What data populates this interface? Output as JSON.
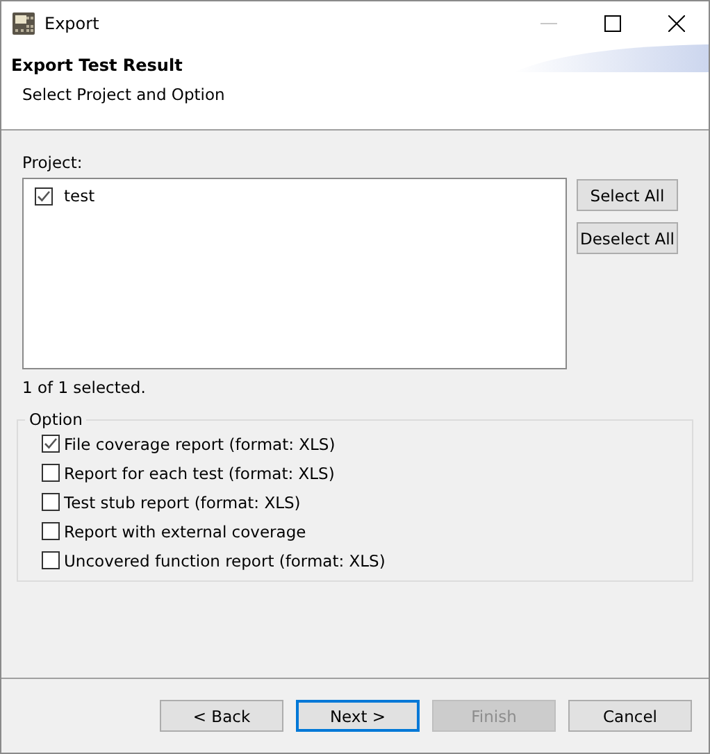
{
  "window": {
    "title": "Export",
    "minimize_disabled": true
  },
  "header": {
    "title": "Export Test Result",
    "subtitle": "Select Project and Option"
  },
  "project": {
    "label": "Project:",
    "items": [
      {
        "label": "test",
        "checked": true
      }
    ],
    "buttons": [
      "Select All",
      "Deselect All"
    ],
    "status": "1 of 1 selected."
  },
  "option": {
    "title": "Option",
    "items": [
      {
        "label": "File coverage report (format: XLS)",
        "checked": true
      },
      {
        "label": "Report for each test (format: XLS)",
        "checked": false
      },
      {
        "label": "Test stub report (format: XLS)",
        "checked": false
      },
      {
        "label": "Report with external coverage",
        "checked": false
      },
      {
        "label": "Uncovered function report (format: XLS)",
        "checked": false
      }
    ]
  },
  "buttons": [
    {
      "label": "< Back",
      "kind": "normal",
      "disabled": false
    },
    {
      "label": "Next >",
      "kind": "default",
      "disabled": false
    },
    {
      "label": "Finish",
      "kind": "normal",
      "disabled": true
    },
    {
      "label": "Cancel",
      "kind": "normal",
      "disabled": false
    }
  ]
}
